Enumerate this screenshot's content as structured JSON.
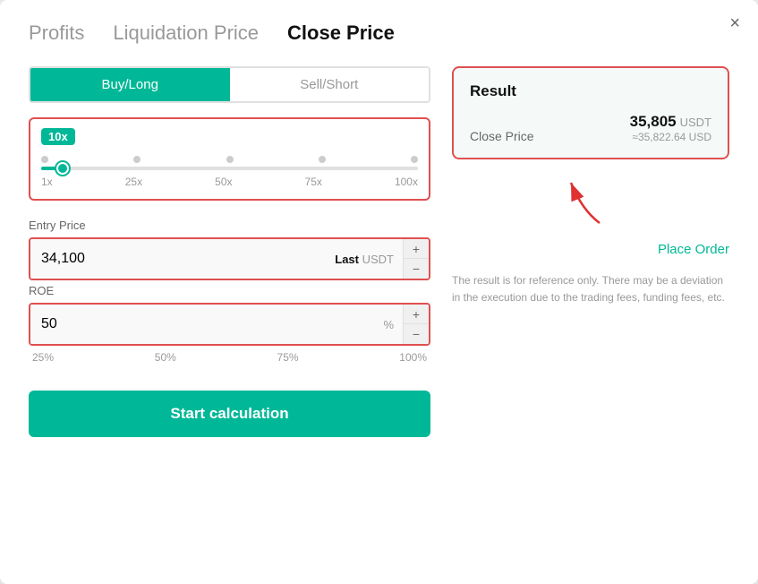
{
  "modal": {
    "close_label": "×"
  },
  "tabs": {
    "profits": "Profits",
    "liquidation_price": "Liquidation Price",
    "close_price": "Close Price",
    "active": "close_price"
  },
  "left": {
    "buy_long_label": "Buy/Long",
    "sell_short_label": "Sell/Short",
    "leverage_badge": "10x",
    "slider_labels": [
      "1x",
      "25x",
      "50x",
      "75x",
      "100x"
    ],
    "entry_price_label": "Entry Price",
    "entry_price_value": "34,100",
    "entry_price_suffix_last": "Last",
    "entry_price_suffix_unit": "USDT",
    "roe_label": "ROE",
    "roe_value": "50",
    "roe_unit": "%",
    "percent_options": [
      "25%",
      "50%",
      "75%",
      "100%"
    ],
    "start_btn_label": "Start calculation",
    "stepper_plus": "+",
    "stepper_minus": "−"
  },
  "right": {
    "result_title": "Result",
    "close_price_label": "Close Price",
    "close_price_value": "35,805",
    "close_price_unit": "USDT",
    "close_price_approx": "≈35,822.64 USD",
    "place_order_label": "Place Order",
    "disclaimer": "The result is for reference only. There may be a deviation in the execution due to the trading fees, funding fees, etc."
  }
}
